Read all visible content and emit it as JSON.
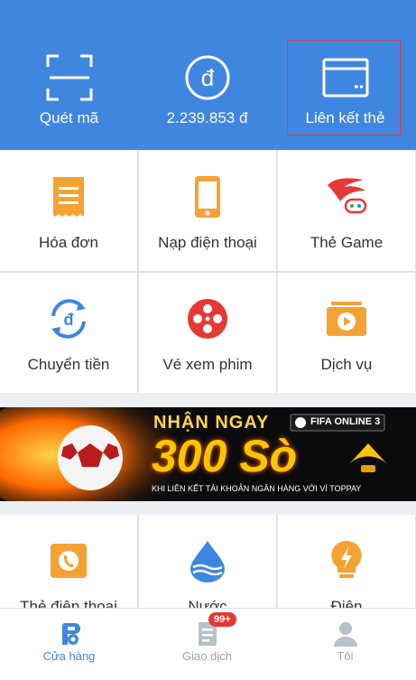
{
  "header": {
    "items": [
      {
        "label": "Quét mã",
        "icon": "scan-icon"
      },
      {
        "label": "2.239.853 đ",
        "icon": "dong-coin-icon"
      },
      {
        "label": "Liên kết thẻ",
        "icon": "card-link-icon"
      }
    ]
  },
  "grid1": [
    {
      "label": "Hóa đơn",
      "icon": "bill-icon"
    },
    {
      "label": "Nạp điện thoại",
      "icon": "phone-topup-icon"
    },
    {
      "label": "Thẻ Game",
      "icon": "game-card-icon"
    },
    {
      "label": "Chuyển tiền",
      "icon": "transfer-icon"
    },
    {
      "label": "Vé xem phim",
      "icon": "film-reel-icon"
    },
    {
      "label": "Dịch vụ",
      "icon": "services-icon"
    }
  ],
  "banner": {
    "line1": "NHẬN NGAY",
    "brand": "FIFA ONLINE 3",
    "headline": "300 Sò",
    "subtitle": "KHI LIÊN KẾT TÀI KHOẢN NGÂN HÀNG VỚI VÍ TOPPAY"
  },
  "grid2": [
    {
      "label": "Thẻ điện thoại",
      "icon": "phone-card-icon"
    },
    {
      "label": "Nước",
      "icon": "water-drop-icon"
    },
    {
      "label": "Điện",
      "icon": "bulb-icon"
    }
  ],
  "tabs": [
    {
      "label": "Cửa hàng",
      "icon": "store-icon",
      "active": true
    },
    {
      "label": "Giao dịch",
      "icon": "transactions-icon",
      "badge": "99+"
    },
    {
      "label": "Tôi",
      "icon": "profile-icon"
    }
  ],
  "colors": {
    "primary": "#3f86e0",
    "orange": "#f5a235",
    "red": "#e53935",
    "tab_inactive": "#9aa3ad"
  }
}
